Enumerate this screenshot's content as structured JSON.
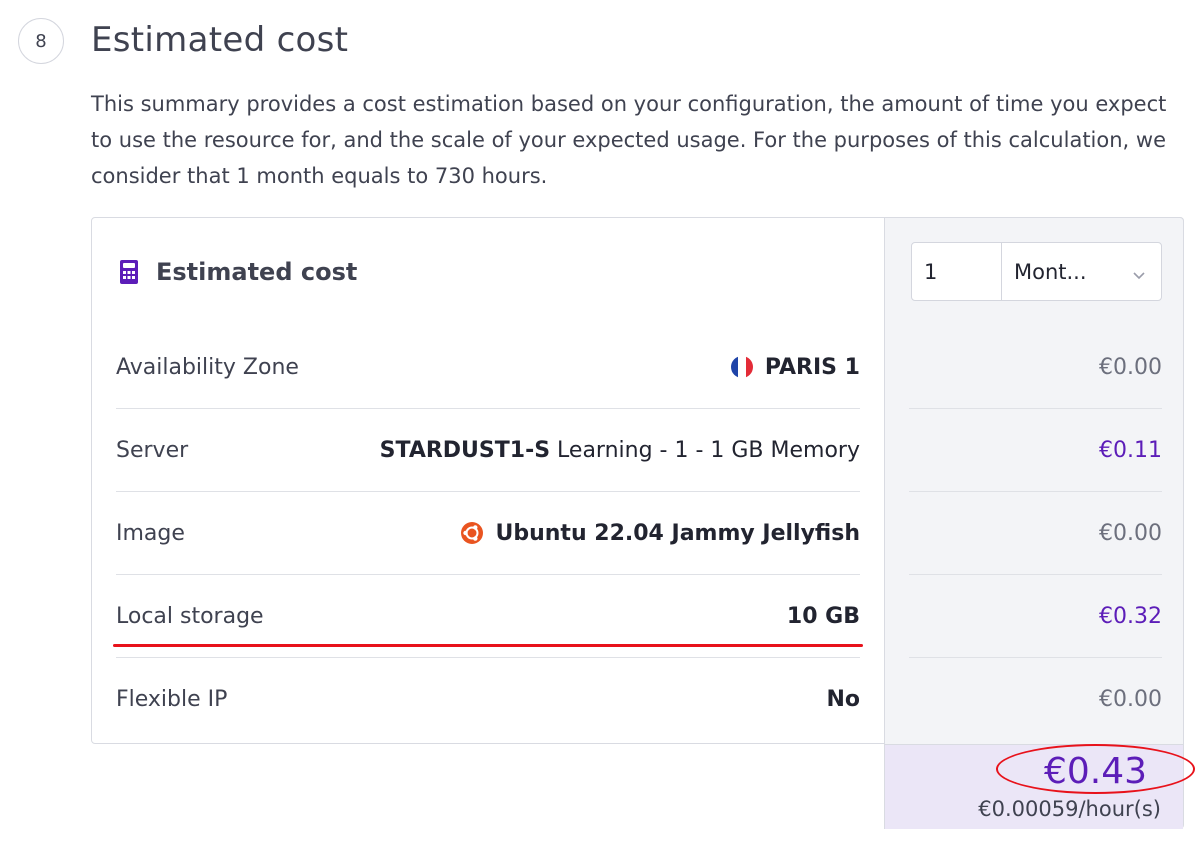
{
  "section": {
    "step_number": "8",
    "title": "Estimated cost",
    "description": "This summary provides a cost estimation based on your configuration, the amount of time you expect to use the resource for, and the scale of your expected usage. For the purposes of this calculation, we consider that 1 month equals to 730 hours."
  },
  "card": {
    "title": "Estimated cost",
    "icon": "calculator-icon",
    "rows": [
      {
        "label": "Availability Zone",
        "value": "PARIS 1",
        "icon": "france-flag-icon",
        "price": "€0.00"
      },
      {
        "label": "Server",
        "value_bold": "STARDUST1-S",
        "value_rest": " Learning - 1 - 1 GB Memory",
        "price": "€0.11"
      },
      {
        "label": "Image",
        "value": "Ubuntu 22.04 Jammy Jellyfish",
        "icon": "ubuntu-icon",
        "price": "€0.00"
      },
      {
        "label": "Local storage",
        "value": "10 GB",
        "price": "€0.32"
      },
      {
        "label": "Flexible IP",
        "value": "No",
        "price": "€0.00"
      }
    ]
  },
  "duration": {
    "value": "1",
    "unit": "Mont..."
  },
  "total": {
    "price": "€0.43",
    "hourly": "€0.00059/hour(s)"
  },
  "colors": {
    "accent": "#5c1db8",
    "annotation": "#e8121b",
    "total_bg": "#ebe6f7"
  }
}
